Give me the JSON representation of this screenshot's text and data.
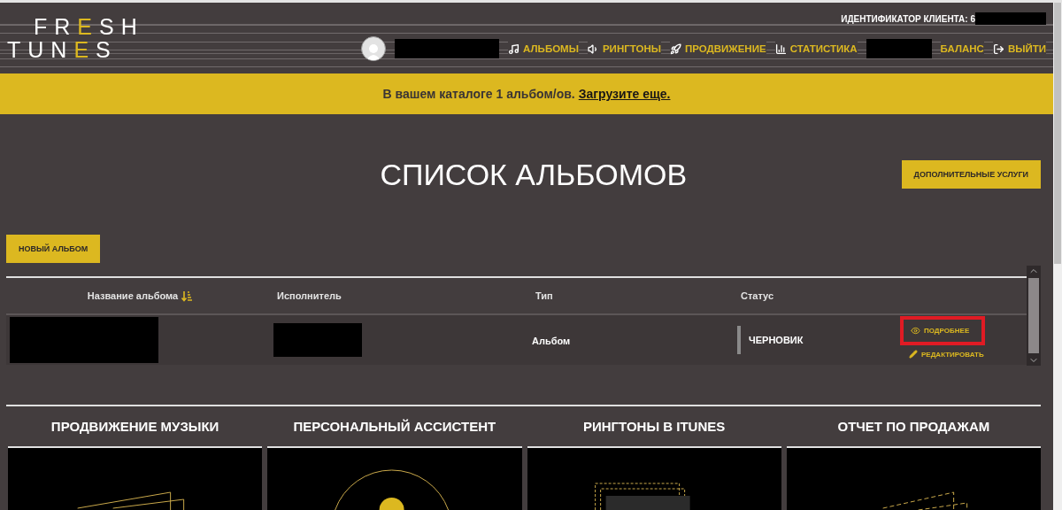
{
  "header": {
    "logo": [
      [
        {
          "text": "FR",
          "accent": false
        },
        {
          "text": "E",
          "accent": true
        },
        {
          "text": "SH",
          "accent": false
        }
      ],
      [
        {
          "text": "TUN",
          "accent": false
        },
        {
          "text": "E",
          "accent": true
        },
        {
          "text": "S",
          "accent": false
        }
      ]
    ],
    "client_id": {
      "label": "ИДЕНТИФИКАТОР КЛИЕНТА: 6"
    },
    "nav": [
      {
        "kind": "avatar"
      },
      {
        "kind": "redacted"
      },
      {
        "kind": "link",
        "label": "АЛЬБОМЫ"
      },
      {
        "kind": "link",
        "label": "РИНГТОНЫ"
      },
      {
        "kind": "link",
        "label": "ПРОДВИЖЕНИЕ"
      },
      {
        "kind": "link",
        "label": "СТАТИСТИКА"
      },
      {
        "kind": "redacted"
      },
      {
        "kind": "link",
        "label": "БАЛАНС"
      },
      {
        "kind": "link",
        "label": "ВЫЙТИ"
      }
    ]
  },
  "banner": {
    "text": "В вашем каталоге 1 альбом/ов.",
    "link": "Загрузите еще."
  },
  "page_title": "СПИСОК АЛЬБОМОВ",
  "extra_services_button": "ДОПОЛНИТЕЛЬНЫЕ УСЛУГИ",
  "new_album_button": "НОВЫЙ АЛЬБОМ",
  "table": {
    "columns": [
      {
        "label": "Название альбома",
        "sortable": true
      },
      {
        "label": "Исполнитель",
        "sortable": false
      },
      {
        "label": "Тип",
        "sortable": false
      },
      {
        "label": "Статус",
        "sortable": false
      }
    ],
    "rows": [
      {
        "type": "Альбом",
        "status": "ЧЕРНОВИК",
        "actions": [
          {
            "label": "ПОДРОБНЕЕ",
            "highlighted": true
          },
          {
            "label": "РЕДАКТИРОВАТЬ",
            "highlighted": false
          }
        ]
      }
    ]
  },
  "services": [
    {
      "title": "ПРОДВИЖЕНИЕ МУЗЫКИ"
    },
    {
      "title": "ПЕРСОНАЛЬНЫЙ АССИСТЕНТ"
    },
    {
      "title": "РИНГТОНЫ В ITUNES"
    },
    {
      "title": "ОТЧЕТ ПО ПРОДАЖАМ"
    }
  ]
}
